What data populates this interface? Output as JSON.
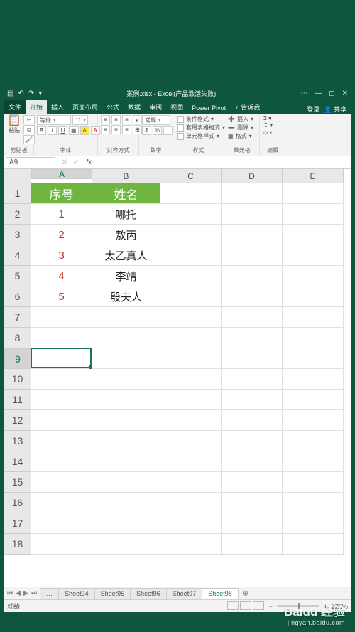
{
  "window": {
    "title": "案例.xlsx - Excel(产品激活失败)",
    "login": "登录",
    "share": "共享"
  },
  "tabs": {
    "file": "文件",
    "items": [
      "开始",
      "插入",
      "页面布局",
      "公式",
      "数据",
      "审阅",
      "视图",
      "Power Pivot"
    ],
    "tell_me": "告诉我…"
  },
  "ribbon": {
    "clipboard": {
      "label": "剪贴板",
      "paste": "粘贴"
    },
    "font": {
      "label": "字体",
      "name": "等线",
      "size": "11"
    },
    "align": {
      "label": "对齐方式"
    },
    "number": {
      "label": "数字",
      "format": "常规"
    },
    "styles": {
      "label": "样式",
      "cond": "条件格式",
      "table": "套用表格格式",
      "cell": "单元格样式"
    },
    "cells": {
      "label": "单元格",
      "insert": "插入",
      "delete": "删除",
      "format": "格式"
    },
    "editing": {
      "label": "编辑"
    }
  },
  "namebox": "A9",
  "grid": {
    "col_widths": {
      "A": 86,
      "B": 96,
      "C": 86,
      "D": 86,
      "E": 86
    },
    "columns": [
      "A",
      "B",
      "C",
      "D",
      "E"
    ],
    "headers": {
      "A": "序号",
      "B": "姓名"
    },
    "rows": [
      {
        "n": 1,
        "A_hdr": true,
        "B_hdr": true
      },
      {
        "n": 2,
        "A": "1",
        "B": "哪托"
      },
      {
        "n": 3,
        "A": "2",
        "B": "敖丙"
      },
      {
        "n": 4,
        "A": "3",
        "B": "太乙真人"
      },
      {
        "n": 5,
        "A": "4",
        "B": "李靖"
      },
      {
        "n": 6,
        "A": "5",
        "B": "殷夫人"
      },
      {
        "n": 7
      },
      {
        "n": 8
      },
      {
        "n": 9
      },
      {
        "n": 10
      },
      {
        "n": 11
      },
      {
        "n": 12
      },
      {
        "n": 13
      },
      {
        "n": 14
      },
      {
        "n": 15
      },
      {
        "n": 16
      },
      {
        "n": 17
      },
      {
        "n": 18
      }
    ],
    "active_row": 9,
    "active_col": "A"
  },
  "sheets": {
    "dots": "…",
    "tabs": [
      "Sheet94",
      "Sheet95",
      "Sheet96",
      "Sheet97",
      "Sheet98"
    ],
    "active": "Sheet98"
  },
  "status": {
    "ready": "就绪",
    "zoom": "220%"
  },
  "watermark": {
    "brand": "Baidu 经验",
    "url": "jingyan.baidu.com"
  }
}
